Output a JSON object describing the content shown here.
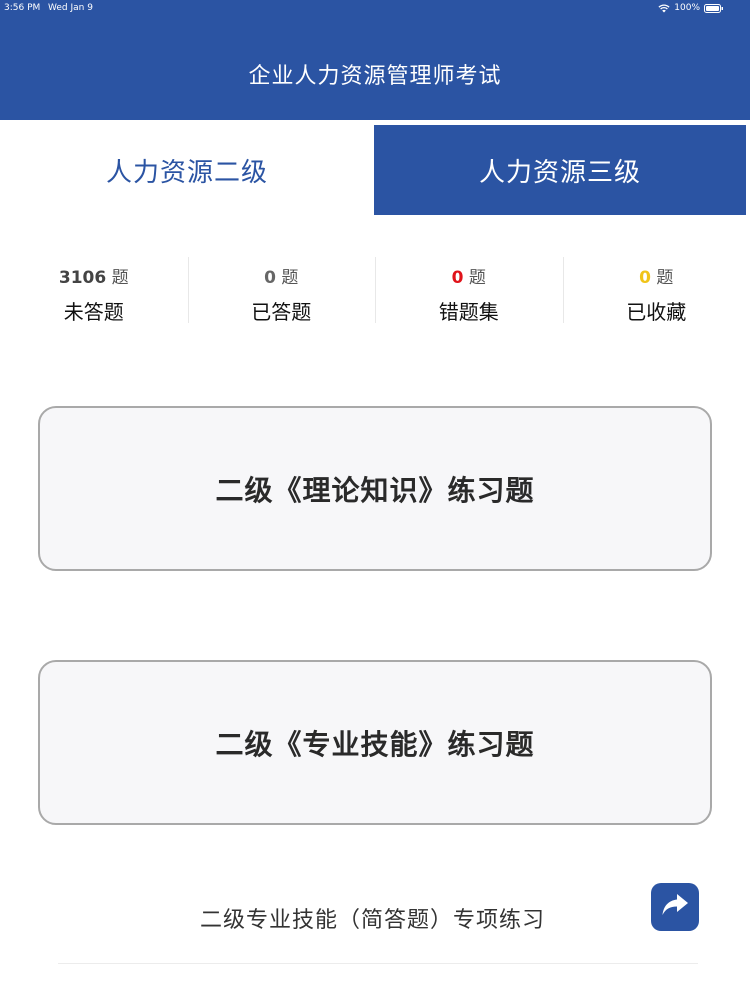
{
  "status_bar": {
    "time": "3:56 PM",
    "date": "Wed Jan 9",
    "battery": "100%",
    "icons": [
      "wifi-icon",
      "battery-icon"
    ]
  },
  "header": {
    "title": "企业人力资源管理师考试"
  },
  "tabs": [
    {
      "label": "人力资源二级",
      "selected": true
    },
    {
      "label": "人力资源三级",
      "selected": false
    }
  ],
  "stats": [
    {
      "count": "3106",
      "unit": "题",
      "label": "未答题",
      "color": "#444444"
    },
    {
      "count": "0",
      "unit": "题",
      "label": "已答题",
      "color": "#666666"
    },
    {
      "count": "0",
      "unit": "题",
      "label": "错题集",
      "color": "#e0131a"
    },
    {
      "count": "0",
      "unit": "题",
      "label": "已收藏",
      "color": "#f0c419"
    }
  ],
  "practice": [
    {
      "label": "二级《理论知识》练习题"
    },
    {
      "label": "二级《专业技能》练习题"
    }
  ],
  "special": {
    "label": "二级专业技能（简答题）专项练习",
    "icon": "share-arrow-icon"
  },
  "colors": {
    "brand_blue": "#2b54a3",
    "card_border": "#a9a9a9",
    "card_bg": "#f7f7f9"
  }
}
